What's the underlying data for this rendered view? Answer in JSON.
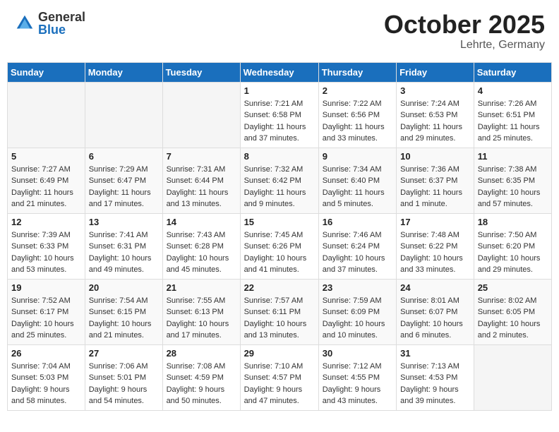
{
  "logo": {
    "general": "General",
    "blue": "Blue"
  },
  "title": {
    "month": "October 2025",
    "location": "Lehrte, Germany"
  },
  "headers": [
    "Sunday",
    "Monday",
    "Tuesday",
    "Wednesday",
    "Thursday",
    "Friday",
    "Saturday"
  ],
  "weeks": [
    [
      {
        "day": "",
        "empty": true
      },
      {
        "day": "",
        "empty": true
      },
      {
        "day": "",
        "empty": true
      },
      {
        "day": "1",
        "sunrise": "Sunrise: 7:21 AM",
        "sunset": "Sunset: 6:58 PM",
        "daylight": "Daylight: 11 hours and 37 minutes."
      },
      {
        "day": "2",
        "sunrise": "Sunrise: 7:22 AM",
        "sunset": "Sunset: 6:56 PM",
        "daylight": "Daylight: 11 hours and 33 minutes."
      },
      {
        "day": "3",
        "sunrise": "Sunrise: 7:24 AM",
        "sunset": "Sunset: 6:53 PM",
        "daylight": "Daylight: 11 hours and 29 minutes."
      },
      {
        "day": "4",
        "sunrise": "Sunrise: 7:26 AM",
        "sunset": "Sunset: 6:51 PM",
        "daylight": "Daylight: 11 hours and 25 minutes."
      }
    ],
    [
      {
        "day": "5",
        "sunrise": "Sunrise: 7:27 AM",
        "sunset": "Sunset: 6:49 PM",
        "daylight": "Daylight: 11 hours and 21 minutes."
      },
      {
        "day": "6",
        "sunrise": "Sunrise: 7:29 AM",
        "sunset": "Sunset: 6:47 PM",
        "daylight": "Daylight: 11 hours and 17 minutes."
      },
      {
        "day": "7",
        "sunrise": "Sunrise: 7:31 AM",
        "sunset": "Sunset: 6:44 PM",
        "daylight": "Daylight: 11 hours and 13 minutes."
      },
      {
        "day": "8",
        "sunrise": "Sunrise: 7:32 AM",
        "sunset": "Sunset: 6:42 PM",
        "daylight": "Daylight: 11 hours and 9 minutes."
      },
      {
        "day": "9",
        "sunrise": "Sunrise: 7:34 AM",
        "sunset": "Sunset: 6:40 PM",
        "daylight": "Daylight: 11 hours and 5 minutes."
      },
      {
        "day": "10",
        "sunrise": "Sunrise: 7:36 AM",
        "sunset": "Sunset: 6:37 PM",
        "daylight": "Daylight: 11 hours and 1 minute."
      },
      {
        "day": "11",
        "sunrise": "Sunrise: 7:38 AM",
        "sunset": "Sunset: 6:35 PM",
        "daylight": "Daylight: 10 hours and 57 minutes."
      }
    ],
    [
      {
        "day": "12",
        "sunrise": "Sunrise: 7:39 AM",
        "sunset": "Sunset: 6:33 PM",
        "daylight": "Daylight: 10 hours and 53 minutes."
      },
      {
        "day": "13",
        "sunrise": "Sunrise: 7:41 AM",
        "sunset": "Sunset: 6:31 PM",
        "daylight": "Daylight: 10 hours and 49 minutes."
      },
      {
        "day": "14",
        "sunrise": "Sunrise: 7:43 AM",
        "sunset": "Sunset: 6:28 PM",
        "daylight": "Daylight: 10 hours and 45 minutes."
      },
      {
        "day": "15",
        "sunrise": "Sunrise: 7:45 AM",
        "sunset": "Sunset: 6:26 PM",
        "daylight": "Daylight: 10 hours and 41 minutes."
      },
      {
        "day": "16",
        "sunrise": "Sunrise: 7:46 AM",
        "sunset": "Sunset: 6:24 PM",
        "daylight": "Daylight: 10 hours and 37 minutes."
      },
      {
        "day": "17",
        "sunrise": "Sunrise: 7:48 AM",
        "sunset": "Sunset: 6:22 PM",
        "daylight": "Daylight: 10 hours and 33 minutes."
      },
      {
        "day": "18",
        "sunrise": "Sunrise: 7:50 AM",
        "sunset": "Sunset: 6:20 PM",
        "daylight": "Daylight: 10 hours and 29 minutes."
      }
    ],
    [
      {
        "day": "19",
        "sunrise": "Sunrise: 7:52 AM",
        "sunset": "Sunset: 6:17 PM",
        "daylight": "Daylight: 10 hours and 25 minutes."
      },
      {
        "day": "20",
        "sunrise": "Sunrise: 7:54 AM",
        "sunset": "Sunset: 6:15 PM",
        "daylight": "Daylight: 10 hours and 21 minutes."
      },
      {
        "day": "21",
        "sunrise": "Sunrise: 7:55 AM",
        "sunset": "Sunset: 6:13 PM",
        "daylight": "Daylight: 10 hours and 17 minutes."
      },
      {
        "day": "22",
        "sunrise": "Sunrise: 7:57 AM",
        "sunset": "Sunset: 6:11 PM",
        "daylight": "Daylight: 10 hours and 13 minutes."
      },
      {
        "day": "23",
        "sunrise": "Sunrise: 7:59 AM",
        "sunset": "Sunset: 6:09 PM",
        "daylight": "Daylight: 10 hours and 10 minutes."
      },
      {
        "day": "24",
        "sunrise": "Sunrise: 8:01 AM",
        "sunset": "Sunset: 6:07 PM",
        "daylight": "Daylight: 10 hours and 6 minutes."
      },
      {
        "day": "25",
        "sunrise": "Sunrise: 8:02 AM",
        "sunset": "Sunset: 6:05 PM",
        "daylight": "Daylight: 10 hours and 2 minutes."
      }
    ],
    [
      {
        "day": "26",
        "sunrise": "Sunrise: 7:04 AM",
        "sunset": "Sunset: 5:03 PM",
        "daylight": "Daylight: 9 hours and 58 minutes."
      },
      {
        "day": "27",
        "sunrise": "Sunrise: 7:06 AM",
        "sunset": "Sunset: 5:01 PM",
        "daylight": "Daylight: 9 hours and 54 minutes."
      },
      {
        "day": "28",
        "sunrise": "Sunrise: 7:08 AM",
        "sunset": "Sunset: 4:59 PM",
        "daylight": "Daylight: 9 hours and 50 minutes."
      },
      {
        "day": "29",
        "sunrise": "Sunrise: 7:10 AM",
        "sunset": "Sunset: 4:57 PM",
        "daylight": "Daylight: 9 hours and 47 minutes."
      },
      {
        "day": "30",
        "sunrise": "Sunrise: 7:12 AM",
        "sunset": "Sunset: 4:55 PM",
        "daylight": "Daylight: 9 hours and 43 minutes."
      },
      {
        "day": "31",
        "sunrise": "Sunrise: 7:13 AM",
        "sunset": "Sunset: 4:53 PM",
        "daylight": "Daylight: 9 hours and 39 minutes."
      },
      {
        "day": "",
        "empty": true
      }
    ]
  ]
}
